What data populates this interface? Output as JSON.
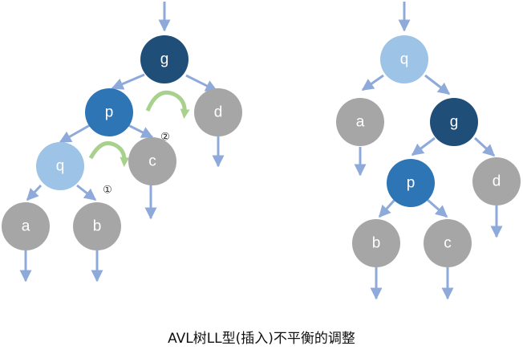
{
  "caption": "AVL树LL型(插入)不平衡的调整",
  "colors": {
    "arrow": "#8eaadb",
    "rotate_arrow": "#a9d18e",
    "node_dark": "#1f4e79",
    "node_mid": "#2e75b6",
    "node_light": "#9dc3e6",
    "node_gray": "#a6a6a6"
  },
  "left_tree": {
    "nodes": {
      "g": {
        "label": "g",
        "color": "node_dark"
      },
      "p": {
        "label": "p",
        "color": "node_mid"
      },
      "q": {
        "label": "q",
        "color": "node_light"
      },
      "d": {
        "label": "d",
        "color": "node_gray"
      },
      "c": {
        "label": "c",
        "color": "node_gray"
      },
      "a": {
        "label": "a",
        "color": "node_gray"
      },
      "b": {
        "label": "b",
        "color": "node_gray"
      }
    },
    "step_labels": {
      "first": "①",
      "second": "②"
    }
  },
  "right_tree": {
    "nodes": {
      "q": {
        "label": "q",
        "color": "node_light"
      },
      "a": {
        "label": "a",
        "color": "node_gray"
      },
      "g": {
        "label": "g",
        "color": "node_dark"
      },
      "p": {
        "label": "p",
        "color": "node_mid"
      },
      "d": {
        "label": "d",
        "color": "node_gray"
      },
      "b": {
        "label": "b",
        "color": "node_gray"
      },
      "c": {
        "label": "c",
        "color": "node_gray"
      }
    }
  }
}
